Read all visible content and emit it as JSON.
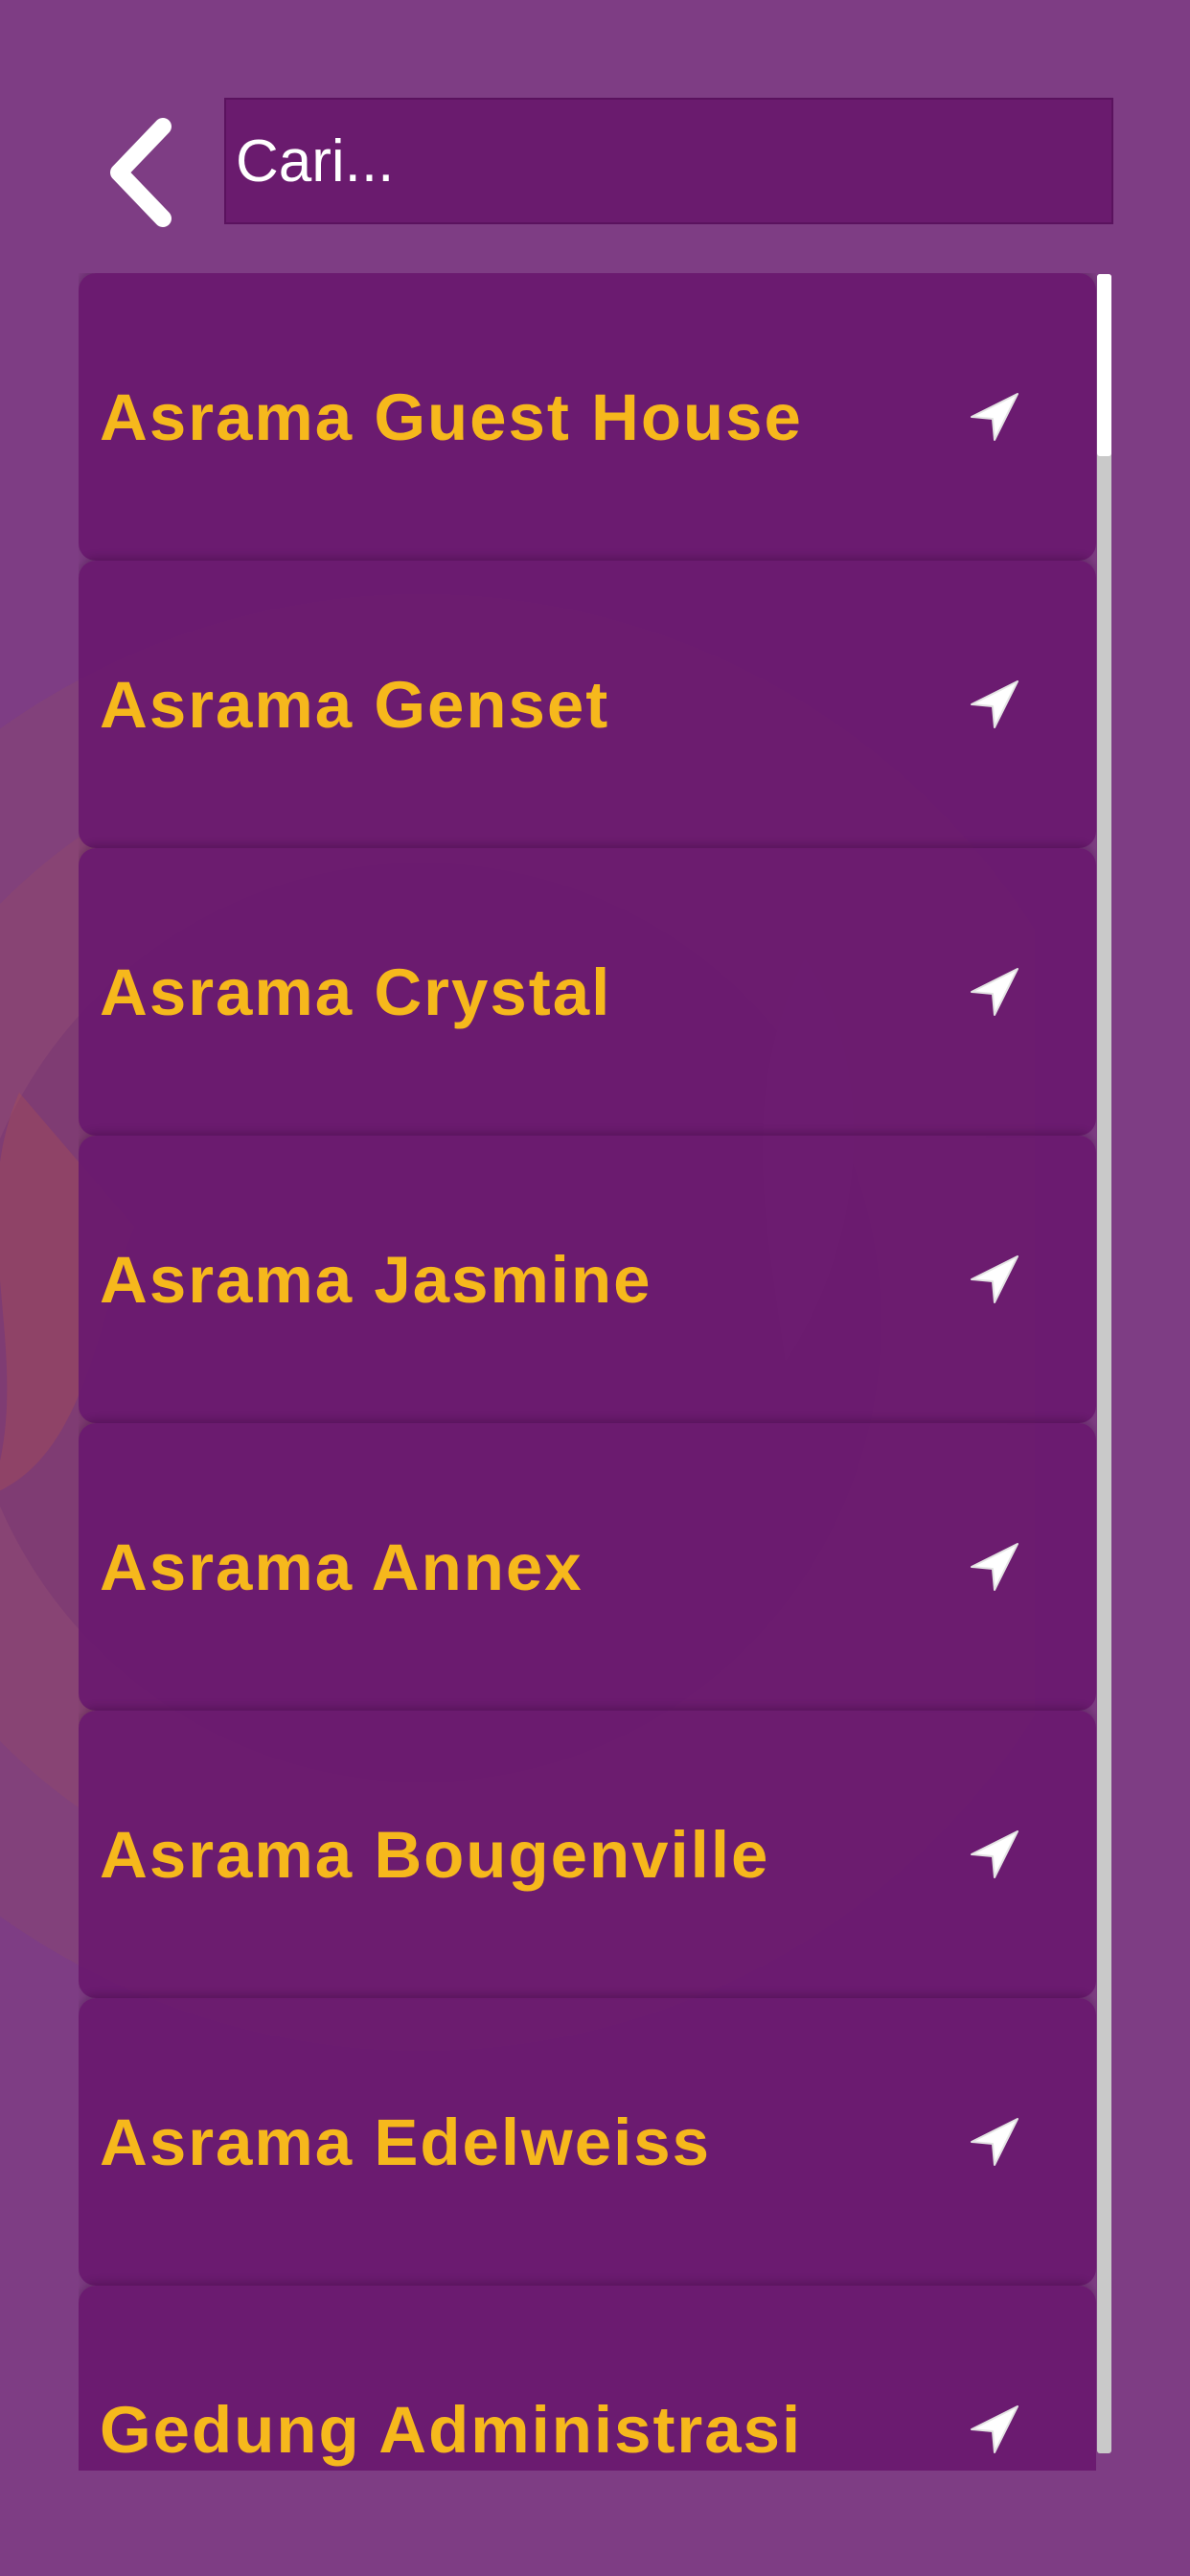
{
  "search": {
    "placeholder": "Cari..."
  },
  "icons": {
    "back": "chevron-left-icon",
    "navigate": "navigation-arrow-icon"
  },
  "colors": {
    "background": "#7e3d84",
    "item_background": "#6a1a6e",
    "item_text": "#f6b81c",
    "search_background": "#6a1b6e"
  },
  "locations": [
    {
      "label": "Asrama Guest House"
    },
    {
      "label": "Asrama Genset"
    },
    {
      "label": "Asrama Crystal"
    },
    {
      "label": "Asrama Jasmine"
    },
    {
      "label": "Asrama Annex"
    },
    {
      "label": "Asrama Bougenville"
    },
    {
      "label": "Asrama Edelweiss"
    },
    {
      "label": "Gedung Administrasi"
    }
  ]
}
